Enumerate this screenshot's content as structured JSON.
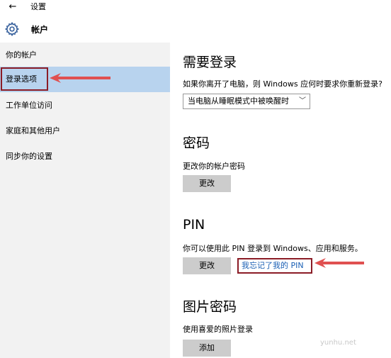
{
  "window": {
    "title": "设置"
  },
  "header": {
    "title": "帐户"
  },
  "sidebar": {
    "items": [
      {
        "label": "你的帐户"
      },
      {
        "label": "登录选项"
      },
      {
        "label": "工作单位访问"
      },
      {
        "label": "家庭和其他用户"
      },
      {
        "label": "同步你的设置"
      }
    ]
  },
  "sections": {
    "signin": {
      "title": "需要登录",
      "desc": "如果你离开了电脑，则 Windows 应何时要求你重新登录?",
      "dropdown_value": "当电脑从睡眠模式中被唤醒时"
    },
    "password": {
      "title": "密码",
      "desc": "更改你的帐户密码",
      "button": "更改"
    },
    "pin": {
      "title": "PIN",
      "desc": "你可以使用此 PIN 登录到 Windows、应用和服务。",
      "button": "更改",
      "link": "我忘记了我的 PIN"
    },
    "picture": {
      "title": "图片密码",
      "desc": "使用喜爱的照片登录",
      "button": "添加"
    }
  },
  "watermark": "yunhu.net",
  "colors": {
    "selected_bg": "#b8d3ee",
    "sidebar_bg": "#f2f2f2",
    "annotation": "#8b1c26",
    "arrow": "#e05050",
    "link": "#1a5fb4"
  },
  "icons": {
    "back": "back-arrow-icon",
    "settings": "gear-icon",
    "dropdown": "chevron-down-icon"
  }
}
